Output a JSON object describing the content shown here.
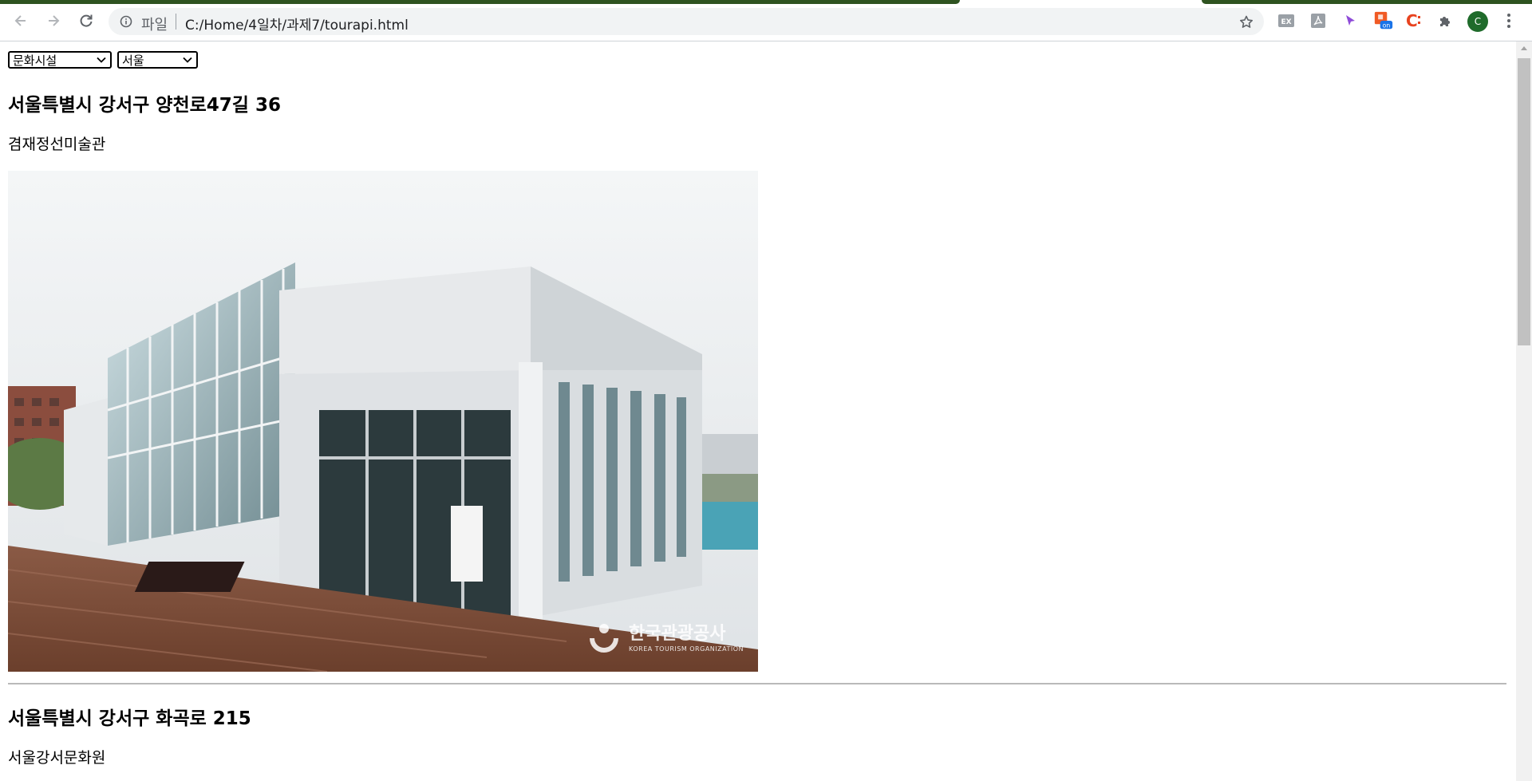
{
  "browser": {
    "scheme_label": "파일",
    "url": "C:/Home/4일차/과제7/tourapi.html",
    "profile_initial": "C",
    "extensions": [
      "ex-icon",
      "acrobat-icon",
      "cursor-icon",
      "on-extension-icon",
      "c-extension-icon",
      "puzzle-icon"
    ]
  },
  "filters": {
    "category": "문화시설",
    "region": "서울"
  },
  "items": [
    {
      "address": "서울특별시 강서구 양천로47길 36",
      "title": "겸재정선미술관",
      "watermark": "한국관광공사",
      "watermark_sub": "KOREA TOURISM ORGANIZATION"
    },
    {
      "address": "서울특별시 강서구 화곡로 215",
      "title": "서울강서문화원"
    }
  ]
}
